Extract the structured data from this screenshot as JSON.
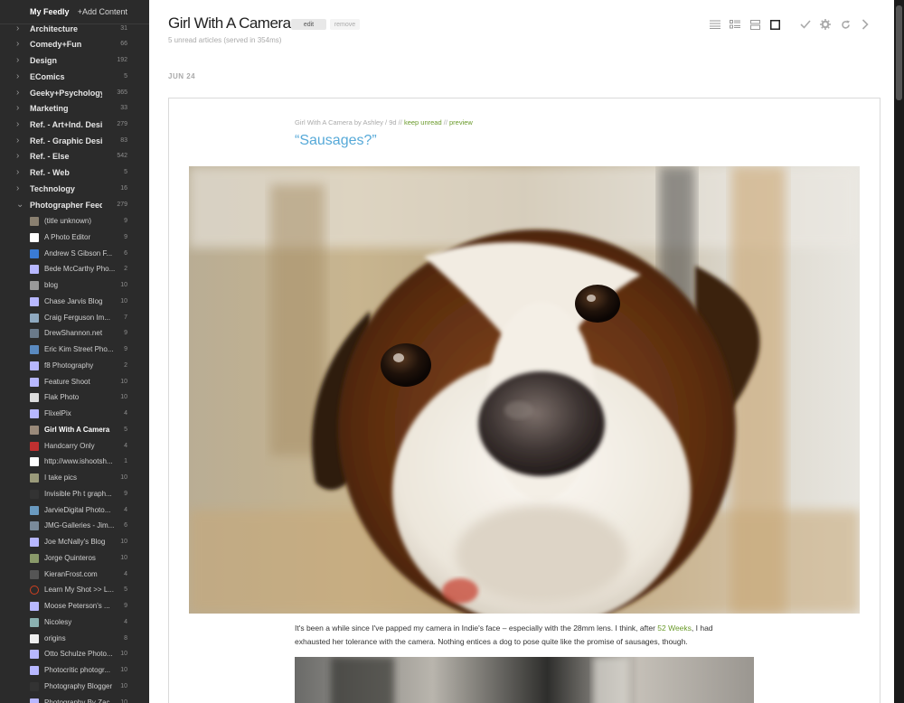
{
  "sidebar": {
    "header": {
      "my_feedly": "My Feedly",
      "add_content": "+Add Content"
    },
    "categories": [
      {
        "label": "Architecture",
        "count": "31"
      },
      {
        "label": "Comedy+Fun",
        "count": "66"
      },
      {
        "label": "Design",
        "count": "192"
      },
      {
        "label": "EComics",
        "count": "5"
      },
      {
        "label": "Geeky+Psychology",
        "count": "365"
      },
      {
        "label": "Marketing",
        "count": "33"
      },
      {
        "label": "Ref. - Art+Ind. Design",
        "count": "279"
      },
      {
        "label": "Ref. - Graphic Design",
        "count": "83"
      },
      {
        "label": "Ref. - Else",
        "count": "542"
      },
      {
        "label": "Ref. - Web",
        "count": "5"
      },
      {
        "label": "Technology",
        "count": "16"
      },
      {
        "label": "Photographer Feeds",
        "count": "279"
      }
    ],
    "feeds": [
      {
        "label": "(title unknown)",
        "count": "9",
        "icon": "image-favicon",
        "color": "#8a8070"
      },
      {
        "label": "A Photo Editor",
        "count": "9",
        "icon": "letter-favicon",
        "color": "#ffffff"
      },
      {
        "label": "Andrew S Gibson F...",
        "count": "6",
        "icon": "letter-favicon",
        "color": "#3a7bd5"
      },
      {
        "label": "Bede McCarthy Pho...",
        "count": "2",
        "icon": "default-favicon",
        "color": "#b7b7ff"
      },
      {
        "label": "blog",
        "count": "10",
        "icon": "image-favicon",
        "color": "#999999"
      },
      {
        "label": "Chase Jarvis Blog",
        "count": "10",
        "icon": "default-favicon",
        "color": "#b7b7ff"
      },
      {
        "label": "Craig Ferguson Im...",
        "count": "7",
        "icon": "image-favicon",
        "color": "#8fa9c0"
      },
      {
        "label": "DrewShannon.net",
        "count": "9",
        "icon": "image-favicon",
        "color": "#6a7a8a"
      },
      {
        "label": "Eric Kim Street Pho...",
        "count": "9",
        "icon": "image-favicon",
        "color": "#5a8ac0"
      },
      {
        "label": "f8 Photography",
        "count": "2",
        "icon": "default-favicon",
        "color": "#b7b7ff"
      },
      {
        "label": "Feature Shoot",
        "count": "10",
        "icon": "default-favicon",
        "color": "#b7b7ff"
      },
      {
        "label": "Flak Photo",
        "count": "10",
        "icon": "image-favicon",
        "color": "#dddddd"
      },
      {
        "label": "FlixelPix",
        "count": "4",
        "icon": "default-favicon",
        "color": "#b7b7ff"
      },
      {
        "label": "Girl With A Camera",
        "count": "5",
        "icon": "image-favicon",
        "color": "#9a8a7a",
        "selected": true
      },
      {
        "label": "Handcarry Only",
        "count": "4",
        "icon": "image-favicon",
        "color": "#c03030"
      },
      {
        "label": "http://www.ishootsh...",
        "count": "1",
        "icon": "image-favicon",
        "color": "#ffffff"
      },
      {
        "label": "I take pics",
        "count": "10",
        "icon": "image-favicon",
        "color": "#9a9a7a"
      },
      {
        "label": "Invisible Ph t graph...",
        "count": "9",
        "icon": "image-favicon",
        "color": "#333333"
      },
      {
        "label": "JarvieDigital Photo...",
        "count": "4",
        "icon": "image-favicon",
        "color": "#6a9ac0"
      },
      {
        "label": "JMG-Galleries - Jim...",
        "count": "6",
        "icon": "image-favicon",
        "color": "#7a8a9a"
      },
      {
        "label": "Joe McNally's Blog",
        "count": "10",
        "icon": "default-favicon",
        "color": "#b7b7ff"
      },
      {
        "label": "Jorge Quinteros",
        "count": "10",
        "icon": "image-favicon",
        "color": "#8a9a6a"
      },
      {
        "label": "KieranFrost.com",
        "count": "4",
        "icon": "image-favicon",
        "color": "#555555"
      },
      {
        "label": "Learn My Shot >> L...",
        "count": "5",
        "icon": "ring-favicon",
        "color": "#d04020"
      },
      {
        "label": "Moose Peterson's ...",
        "count": "9",
        "icon": "default-favicon",
        "color": "#b7b7ff"
      },
      {
        "label": "Nicolesy",
        "count": "4",
        "icon": "image-favicon",
        "color": "#8ab0b0"
      },
      {
        "label": "origins",
        "count": "8",
        "icon": "image-favicon",
        "color": "#eeeeee"
      },
      {
        "label": "Otto Schulze Photo...",
        "count": "10",
        "icon": "default-favicon",
        "color": "#b7b7ff"
      },
      {
        "label": "Photocritic photogr...",
        "count": "10",
        "icon": "default-favicon",
        "color": "#b7b7ff"
      },
      {
        "label": "Photography Blogger",
        "count": "10",
        "icon": "image-favicon",
        "color": "#333333"
      },
      {
        "label": "Photography By Zac...",
        "count": "10",
        "icon": "default-favicon",
        "color": "#b7b7ff"
      }
    ]
  },
  "main": {
    "feed_title": "Girl With A Camera",
    "edit_label": "edit",
    "remove_label": "remove",
    "subtitle": "5 unread articles (served in 354ms)",
    "toolbar": [
      {
        "icon": "titles-view-icon"
      },
      {
        "icon": "magazine-view-icon"
      },
      {
        "icon": "cards-view-icon"
      },
      {
        "icon": "full-article-view-icon"
      },
      {
        "icon": "mark-read-icon"
      },
      {
        "icon": "settings-gear-icon"
      },
      {
        "icon": "refresh-icon"
      },
      {
        "icon": "next-arrow-icon"
      }
    ],
    "date_label": "JUN 24",
    "article": {
      "meta_source": "Girl With A Camera by Ashley",
      "meta_sep1": "/",
      "meta_age": "9d",
      "meta_sep2": "//",
      "keep_unread": "keep unread",
      "meta_sep3": "//",
      "preview": "preview",
      "title": "“Sausages?”",
      "body_before": "It's been a while since I've papped my camera in Indie's face – especially with the 28mm lens. I think, after ",
      "body_link": "52 Weeks",
      "body_after": ", I had exhausted her tolerance with the camera. Nothing entices a dog to pose quite like the promise of sausages, though."
    }
  },
  "colors": {
    "sidebar_bg": "#2b2b2b",
    "title_link": "#56a9d8",
    "action_link": "#6a9a2a",
    "selected_feed": "#ffffff"
  }
}
